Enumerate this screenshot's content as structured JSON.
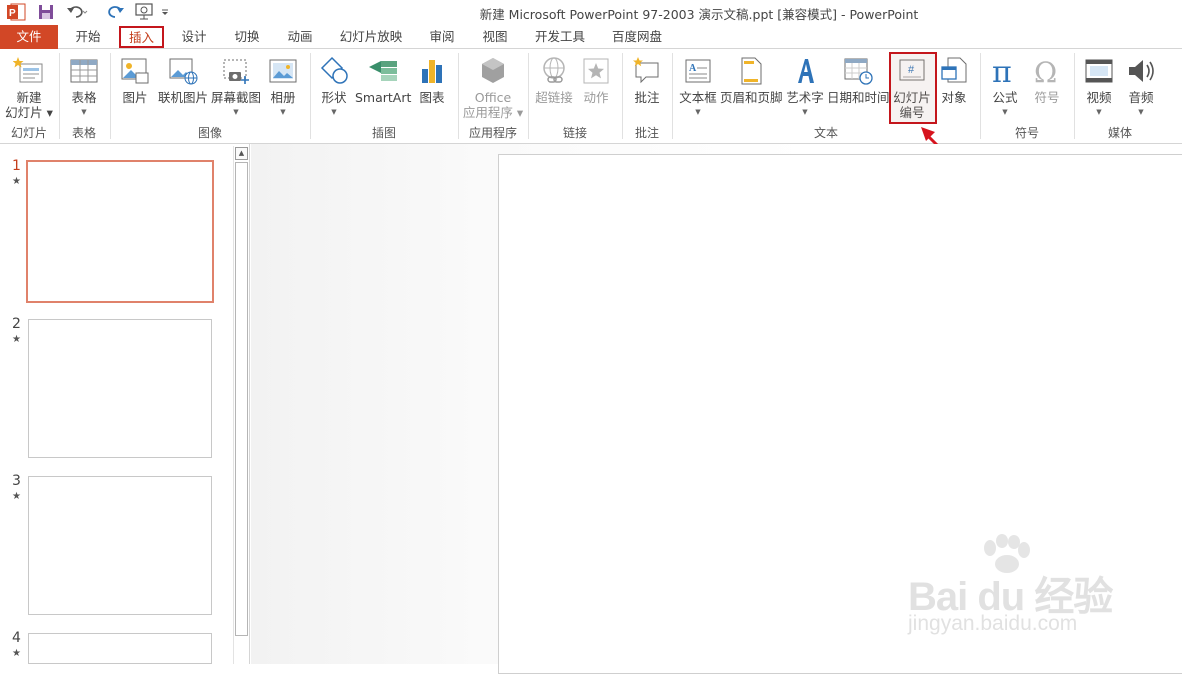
{
  "window": {
    "title": "新建 Microsoft PowerPoint 97-2003 演示文稿.ppt [兼容模式] - PowerPoint"
  },
  "quick_access": {
    "icons": [
      "powerpoint-logo-icon",
      "save-icon",
      "undo-icon",
      "redo-icon",
      "start-slideshow-icon",
      "customize-qat-icon"
    ]
  },
  "tabs": [
    {
      "label": "文件"
    },
    {
      "label": "开始"
    },
    {
      "label": "插入"
    },
    {
      "label": "设计"
    },
    {
      "label": "切换"
    },
    {
      "label": "动画"
    },
    {
      "label": "幻灯片放映"
    },
    {
      "label": "审阅"
    },
    {
      "label": "视图"
    },
    {
      "label": "开发工具"
    },
    {
      "label": "百度网盘"
    }
  ],
  "active_tab": "插入",
  "ribbon": {
    "groups": {
      "slides": {
        "label": "幻灯片",
        "new_slide_line1": "新建",
        "new_slide_line2": "幻灯片"
      },
      "tables": {
        "label": "表格",
        "table": "表格"
      },
      "images": {
        "label": "图像",
        "picture": "图片",
        "online_picture": "联机图片",
        "screenshot": "屏幕截图",
        "album": "相册"
      },
      "illustrations": {
        "label": "插图",
        "shapes": "形状",
        "smartart": "SmartArt",
        "chart": "图表"
      },
      "apps": {
        "label": "应用程序",
        "office_line1": "Office",
        "office_line2": "应用程序"
      },
      "links": {
        "label": "链接",
        "hyperlink": "超链接",
        "action": "动作"
      },
      "comments": {
        "label": "批注",
        "comment": "批注"
      },
      "text": {
        "label": "文本",
        "textbox": "文本框",
        "header_footer": "页眉和页脚",
        "wordart": "艺术字",
        "datetime": "日期和时间",
        "slide_number_line1": "幻灯片",
        "slide_number_line2": "编号",
        "object": "对象"
      },
      "symbols": {
        "label": "符号",
        "equation": "公式",
        "symbol": "符号"
      },
      "media": {
        "label": "媒体",
        "video": "视频",
        "audio": "音频"
      }
    }
  },
  "thumbnails": [
    {
      "number": "1",
      "star": "★",
      "selected": true
    },
    {
      "number": "2",
      "star": "★",
      "selected": false
    },
    {
      "number": "3",
      "star": "★",
      "selected": false
    },
    {
      "number": "4",
      "star": "★",
      "selected": false
    }
  ],
  "watermark": {
    "main": "Bai du 经验",
    "sub": "jingyan.baidu.com"
  },
  "colors": {
    "accent": "#d24726",
    "annotation_red": "#c4161c",
    "selection": "#e0826b"
  }
}
